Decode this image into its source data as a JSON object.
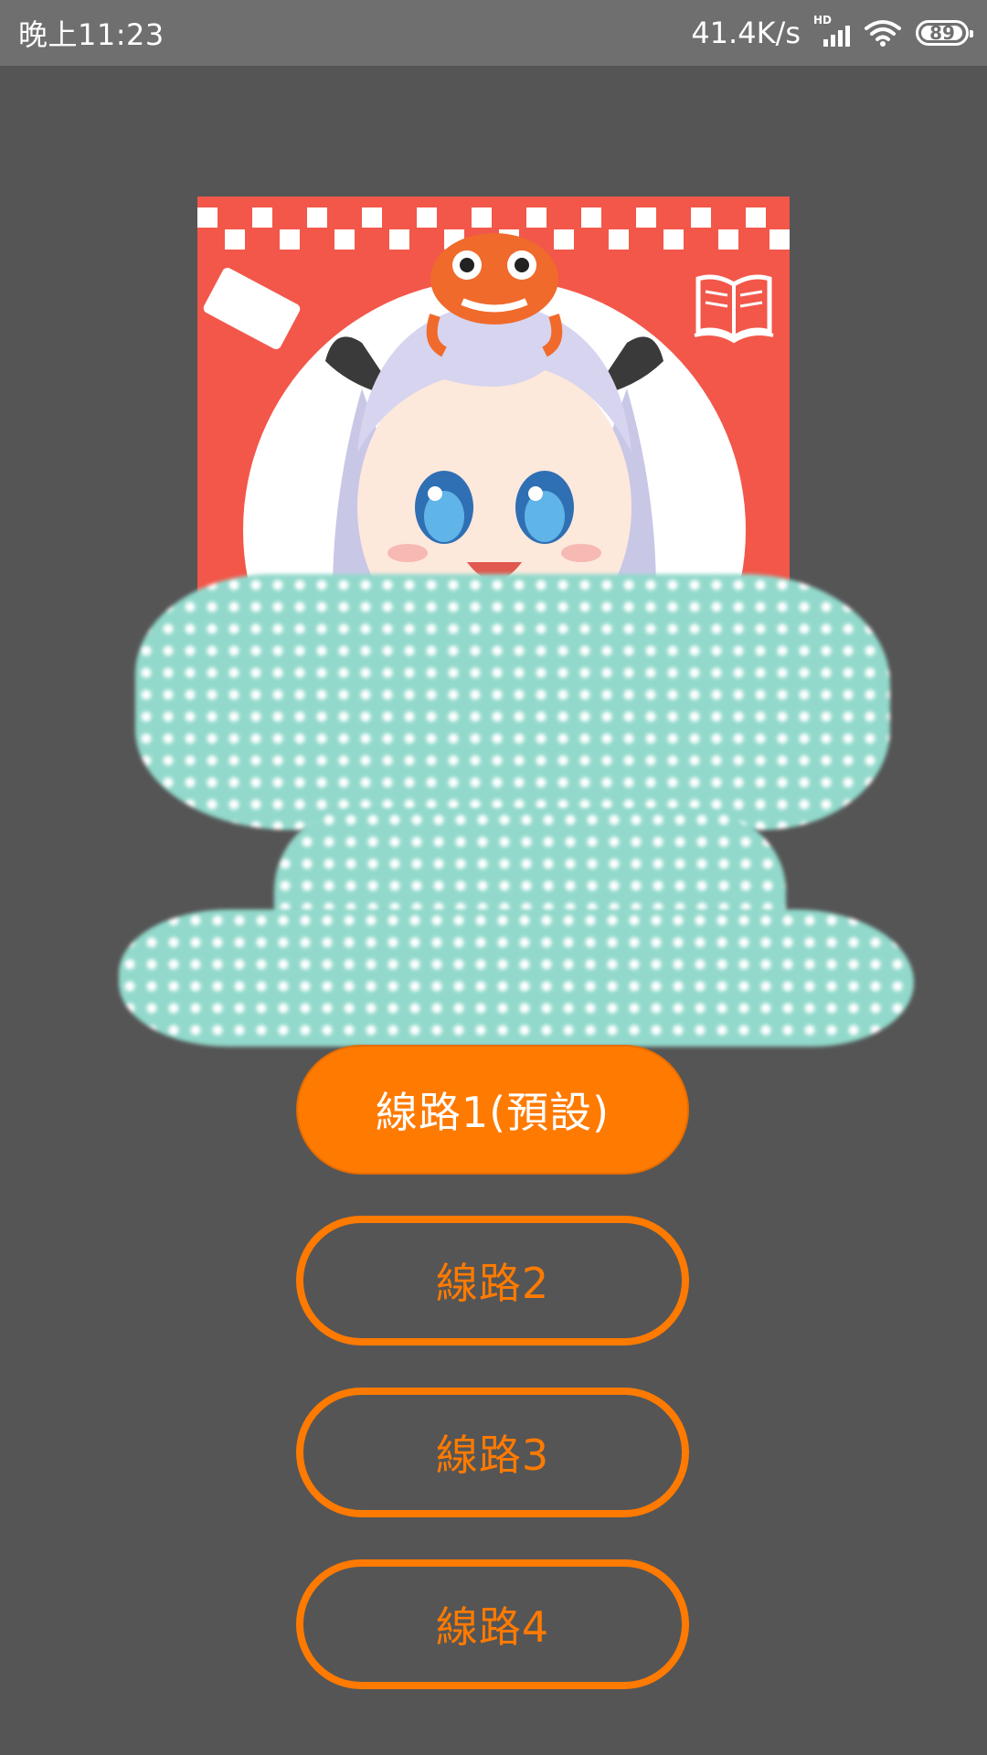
{
  "status_bar": {
    "time": "晚上11:23",
    "network_speed": "41.4K/s",
    "signal_label": "HD",
    "battery_level": "89"
  },
  "logo": {
    "icon": "app-logo-mascot",
    "colors": {
      "background": "#f2574a",
      "circle": "#ffffff"
    }
  },
  "routes": [
    {
      "label": "線路1(預設)",
      "selected": true
    },
    {
      "label": "線路2",
      "selected": false
    },
    {
      "label": "線路3",
      "selected": false
    },
    {
      "label": "線路4",
      "selected": false
    }
  ],
  "colors": {
    "background": "#555555",
    "status_bar": "#6f6f6f",
    "accent": "#ff7a00",
    "overlay": "#92d9cb"
  }
}
